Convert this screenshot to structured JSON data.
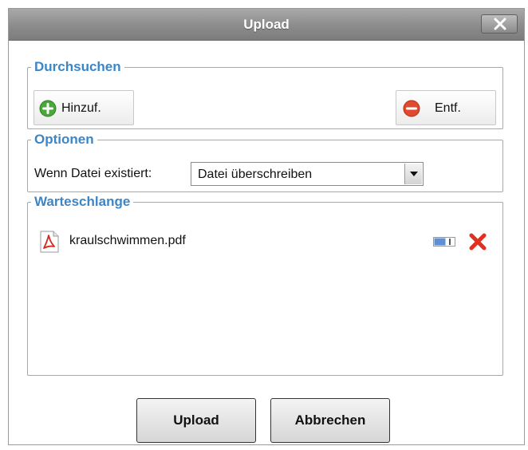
{
  "window": {
    "title": "Upload"
  },
  "browse": {
    "legend": "Durchsuchen",
    "add_label": "Hinzuf.",
    "remove_label": "Entf."
  },
  "options": {
    "legend": "Optionen",
    "label": "Wenn Datei existiert:",
    "selected": "Datei überschreiben"
  },
  "queue": {
    "legend": "Warteschlange",
    "items": [
      {
        "file_name": "kraulschwimmen.pdf"
      }
    ]
  },
  "footer": {
    "upload_label": "Upload",
    "cancel_label": "Abbrechen"
  },
  "colors": {
    "legend_text": "#3d86c6",
    "add_icon": "#4aa83a",
    "remove_icon": "#e04b2f",
    "delete_x": "#e03020"
  }
}
